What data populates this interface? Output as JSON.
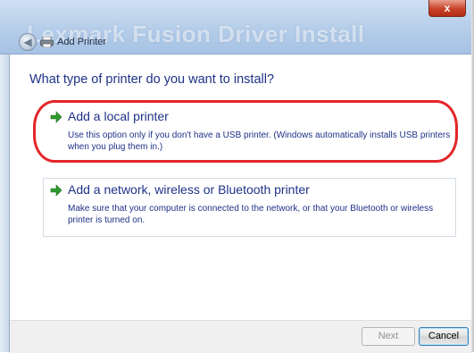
{
  "window": {
    "watermark_title": "Lexmark Fusion Driver Install",
    "dialog_title": "Add Printer",
    "close_label": "x"
  },
  "main": {
    "question": "What type of printer do you want to install?",
    "options": [
      {
        "label": "Add a local printer",
        "description": "Use this option only if you don't have a USB printer. (Windows automatically installs USB printers when you plug them in.)"
      },
      {
        "label": "Add a network, wireless or Bluetooth printer",
        "description": "Make sure that your computer is connected to the network, or that your Bluetooth or wireless printer is turned on."
      }
    ]
  },
  "footer": {
    "next_label": "Next",
    "cancel_label": "Cancel"
  },
  "colors": {
    "link_blue": "#1e3287",
    "highlight_red": "#e3262a",
    "arrow_green": "#2e9a2e"
  }
}
